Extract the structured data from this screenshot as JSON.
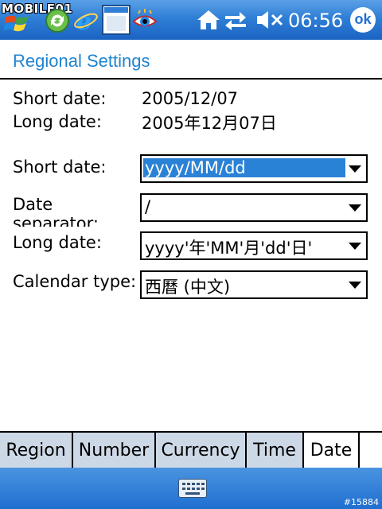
{
  "taskbar": {
    "brand": "MOBILE01",
    "clock": "06:56",
    "ok_label": "ok",
    "icons": [
      "start-flag-icon",
      "sync-icon",
      "browser-icon",
      "window-icon",
      "eye-icon",
      "home-icon",
      "connectivity-icon",
      "speaker-muted-icon"
    ]
  },
  "page": {
    "title": "Regional Settings"
  },
  "preview": {
    "short_label": "Short date:",
    "short_value": "2005/12/07",
    "long_label": "Long date:",
    "long_value": "2005年12月07日"
  },
  "form": {
    "short_date_label": "Short date:",
    "short_date_value": "yyyy/MM/dd",
    "separator_label": "Date separator:",
    "separator_value": "/",
    "long_date_label": "Long date:",
    "long_date_value": "yyyy'年'MM'月'dd'日'",
    "calendar_label": "Calendar type:",
    "calendar_value": "西曆 (中文)"
  },
  "tabs": [
    "Region",
    "Number",
    "Currency",
    "Time",
    "Date"
  ],
  "active_tab": "Date",
  "bottom": {
    "watermark": "#15884",
    "icon": "keyboard-icon"
  },
  "colors": {
    "accent": "#1f84d1",
    "taskbar": "#2f7fd6",
    "selection": "#2a82d6",
    "tab_inactive": "#cdd8e6"
  }
}
